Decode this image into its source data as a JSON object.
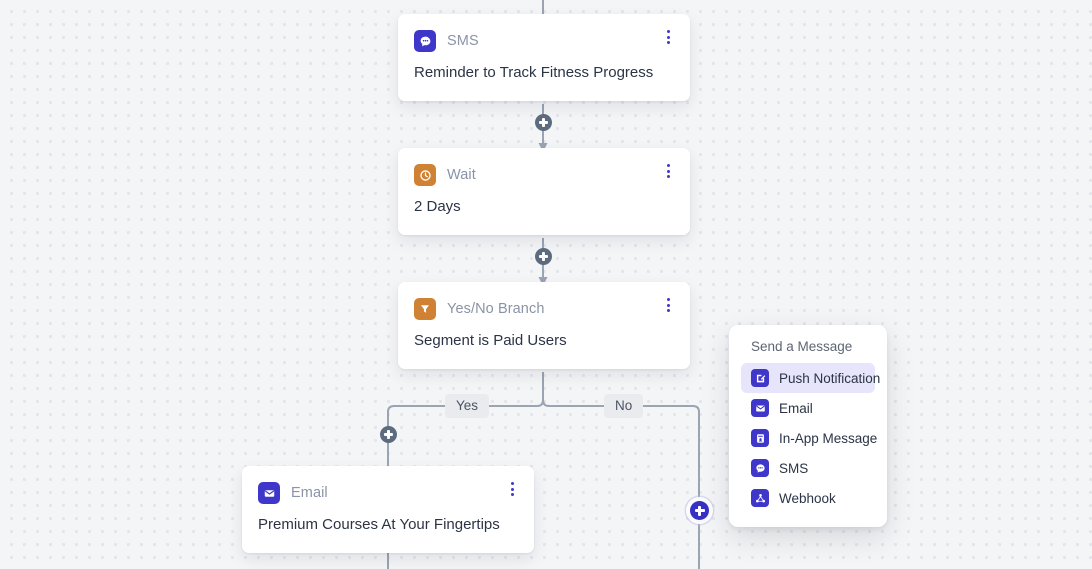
{
  "canvas": {
    "background_color": "#f4f5f7",
    "dot_color": "#e3e5ea"
  },
  "nodes": [
    {
      "id": "sms",
      "type_label": "SMS",
      "title": "Reminder to Track Fitness Progress",
      "icon": "sms-bubble-icon",
      "icon_color": "#3f37c9"
    },
    {
      "id": "wait",
      "type_label": "Wait",
      "title": "2 Days",
      "icon": "clock-icon",
      "icon_color": "#cf8233"
    },
    {
      "id": "branch",
      "type_label": "Yes/No Branch",
      "title": "Segment is Paid Users",
      "icon": "funnel-icon",
      "icon_color": "#cf8233"
    },
    {
      "id": "email",
      "type_label": "Email",
      "title": "Premium Courses At Your Fingertips",
      "icon": "envelope-icon",
      "icon_color": "#3f37c9"
    }
  ],
  "branch_labels": {
    "yes": "Yes",
    "no": "No"
  },
  "add_buttons": [
    {
      "id": "add-after-sms",
      "state": "default"
    },
    {
      "id": "add-after-wait",
      "state": "default"
    },
    {
      "id": "add-yes-branch",
      "state": "default"
    },
    {
      "id": "add-no-branch",
      "state": "active"
    }
  ],
  "menu": {
    "heading": "Send a Message",
    "accent_color": "#3f37c9",
    "selected_background": "#e7e5fb",
    "items": [
      {
        "label": "Push Notification",
        "icon": "push-notification-icon",
        "selected": true
      },
      {
        "label": "Email",
        "icon": "envelope-icon",
        "selected": false
      },
      {
        "label": "In-App Message",
        "icon": "in-app-message-icon",
        "selected": false
      },
      {
        "label": "SMS",
        "icon": "sms-bubble-icon",
        "selected": false
      },
      {
        "label": "Webhook",
        "icon": "webhook-icon",
        "selected": false
      }
    ]
  }
}
